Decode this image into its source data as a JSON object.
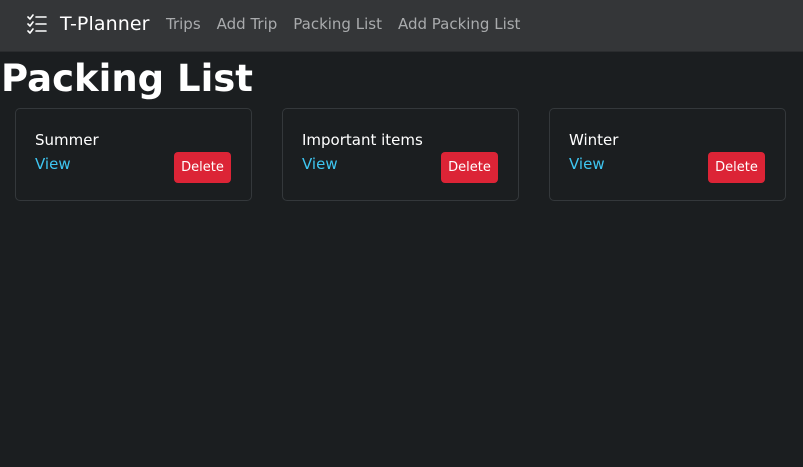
{
  "navbar": {
    "brand_icon": "checklist-icon",
    "brand": "T-Planner",
    "links": [
      "Trips",
      "Add Trip",
      "Packing List",
      "Add Packing List"
    ]
  },
  "page": {
    "title": "Packing List"
  },
  "cards": [
    {
      "title": "Summer",
      "view_label": "View",
      "delete_label": "Delete"
    },
    {
      "title": "Important items",
      "view_label": "View",
      "delete_label": "Delete"
    },
    {
      "title": "Winter",
      "view_label": "View",
      "delete_label": "Delete"
    }
  ],
  "colors": {
    "background": "#1b1e20",
    "navbar": "#343638",
    "link": "#3ec6f1",
    "danger": "#dc2436",
    "nav_text": "#a9abad"
  }
}
